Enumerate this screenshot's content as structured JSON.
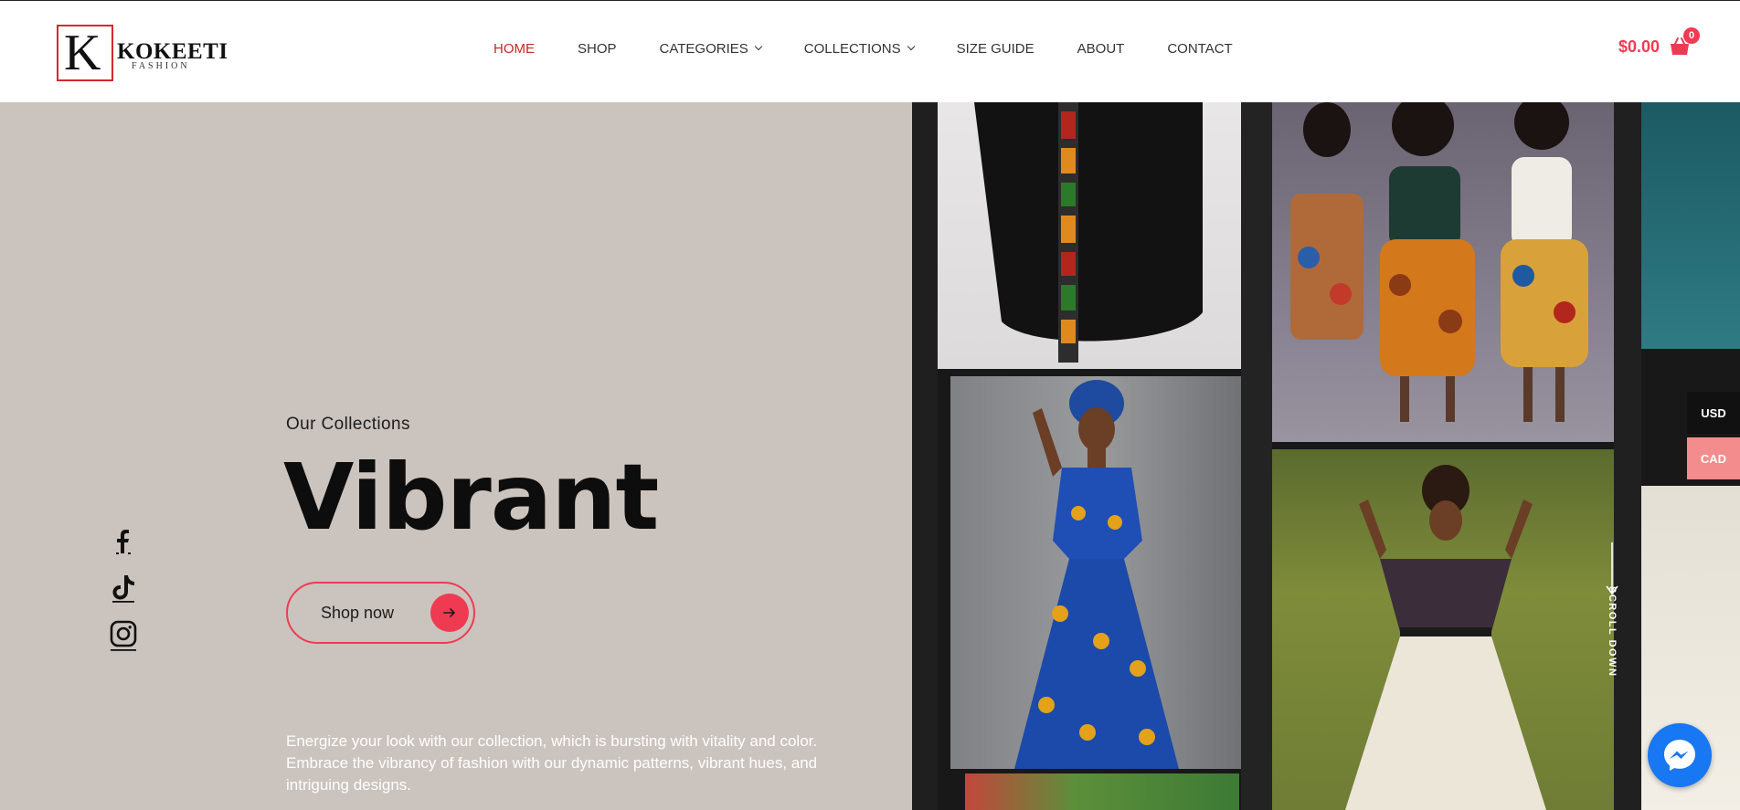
{
  "logo": {
    "letter": "K",
    "name": "KOKEETI",
    "sub": "FASHION"
  },
  "nav": {
    "items": [
      {
        "label": "HOME",
        "active": true,
        "dropdown": false
      },
      {
        "label": "SHOP",
        "active": false,
        "dropdown": false
      },
      {
        "label": "CATEGORIES",
        "active": false,
        "dropdown": true
      },
      {
        "label": "COLLECTIONS",
        "active": false,
        "dropdown": true
      },
      {
        "label": "SIZE GUIDE",
        "active": false,
        "dropdown": false
      },
      {
        "label": "ABOUT",
        "active": false,
        "dropdown": false
      },
      {
        "label": "CONTACT",
        "active": false,
        "dropdown": false
      }
    ]
  },
  "cart": {
    "total": "$0.00",
    "count": "0",
    "icon": "shopping-basket-icon"
  },
  "hero": {
    "eyebrow": "Our Collections",
    "headline": "Vibrant",
    "cta_label": "Shop now",
    "description": "Energize your look with our collection, which is bursting with vitality and color. Embrace the vibrancy of fashion with our dynamic patterns, vibrant hues, and intriguing designs.",
    "scroll_label": "SCROLL DOWN"
  },
  "social": [
    {
      "name": "facebook-icon"
    },
    {
      "name": "tiktok-icon"
    },
    {
      "name": "instagram-icon"
    }
  ],
  "currency": {
    "usd": "USD",
    "cad": "CAD"
  },
  "colors": {
    "accent": "#ef3b52",
    "nav_active": "#c62828",
    "hero_bg": "#cbc3be",
    "messenger": "#1877f2"
  }
}
